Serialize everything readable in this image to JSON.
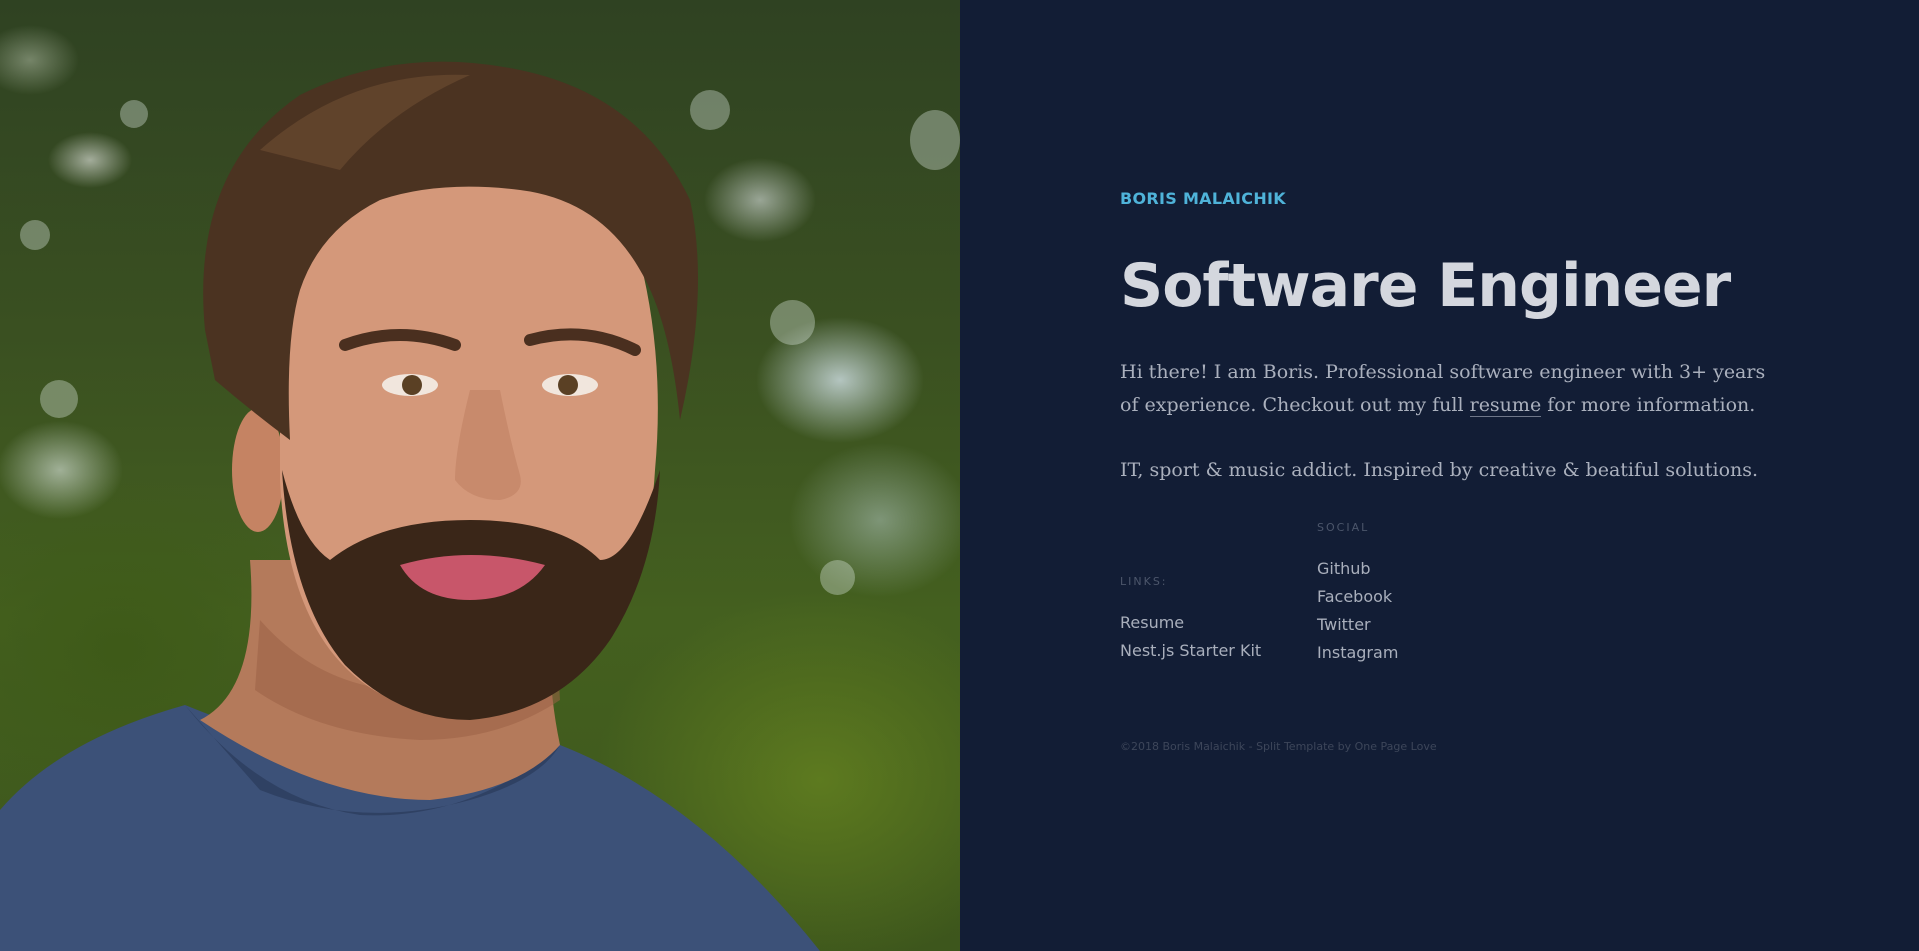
{
  "profile": {
    "name": "BORIS MALAICHIK",
    "title": "Software Engineer",
    "bio_before_link": "Hi there! I am Boris. Professional software engineer with 3+ years of experience. Checkout out my full ",
    "bio_link": "resume",
    "bio_after_link": " for more information.",
    "bio2": "IT, sport & music addict. Inspired by creative & beatiful solutions."
  },
  "links": {
    "label": "LINKS:",
    "items": [
      "Resume",
      "Nest.js Starter Kit"
    ]
  },
  "social": {
    "label": "SOCIAL",
    "items": [
      "Github",
      "Facebook",
      "Twitter",
      "Instagram"
    ]
  },
  "footer": {
    "text": "©2018 Boris Malaichik - Split Template by One Page Love"
  },
  "colors": {
    "background": "#121d35",
    "accent": "#4fb3d9",
    "title": "#d4d7de",
    "body_text": "#aab0bd"
  }
}
